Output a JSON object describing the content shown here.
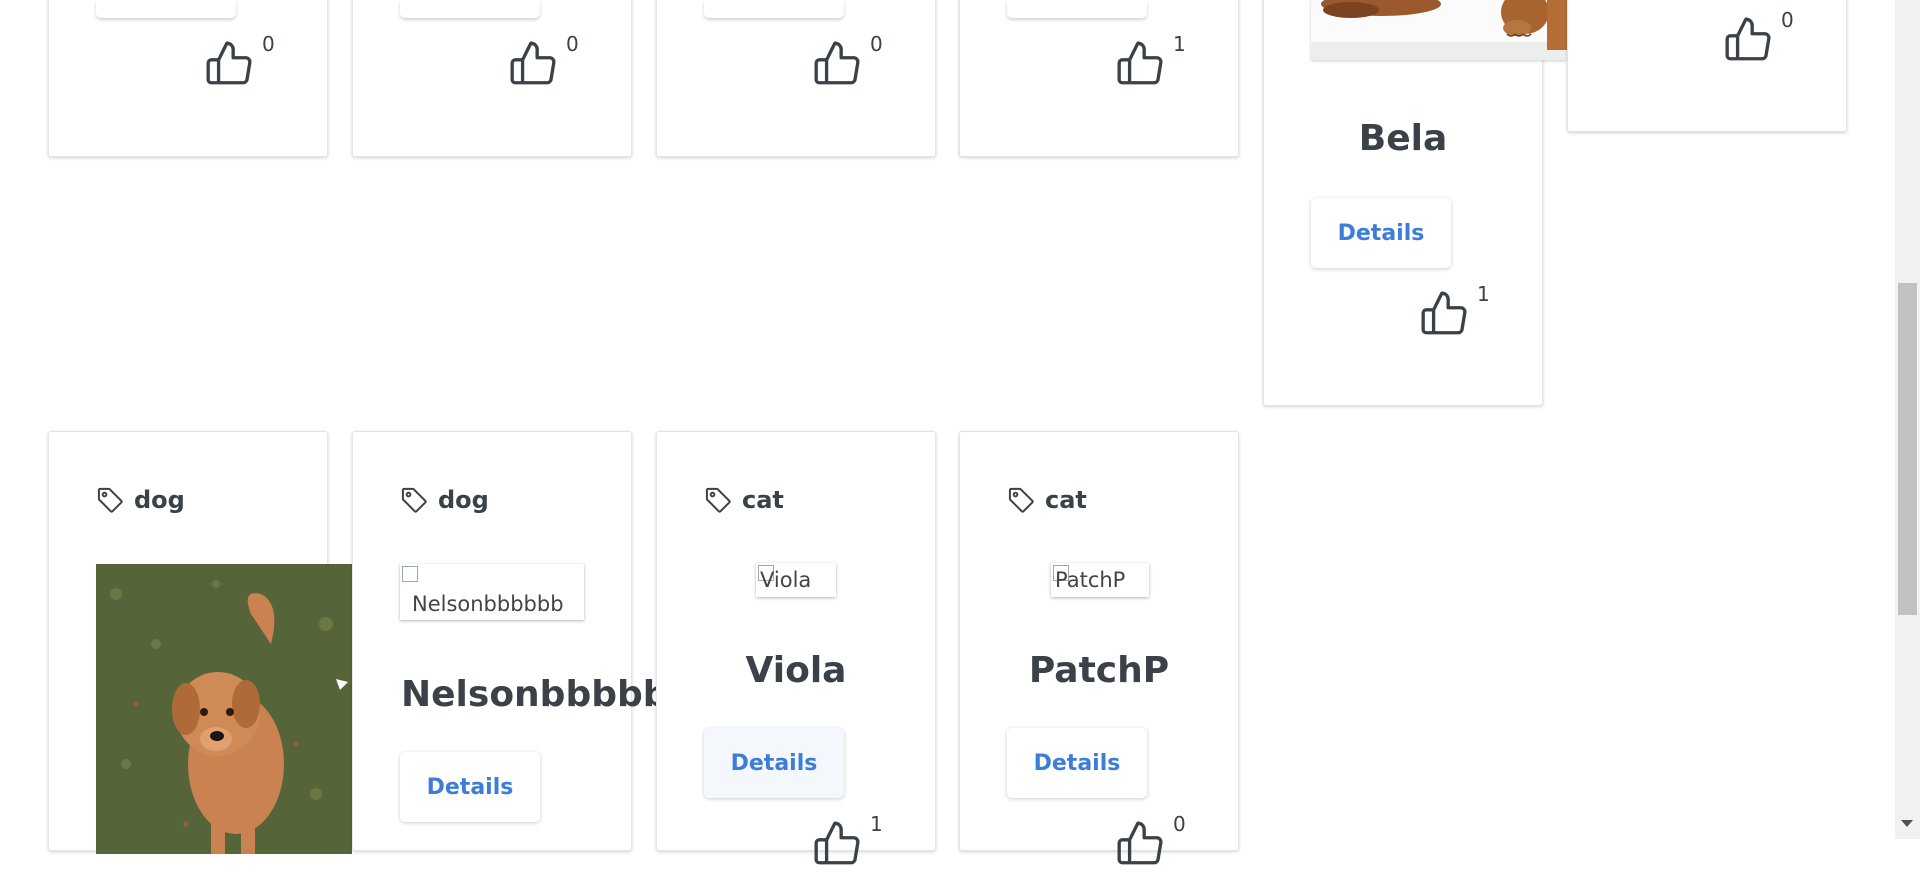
{
  "colors": {
    "accent": "#3b7dd8",
    "text": "#3b4148",
    "card_border": "#e2e4e7"
  },
  "top_row": {
    "likes": [
      "0",
      "0",
      "0",
      "1"
    ],
    "last_card_likes": "0"
  },
  "bela": {
    "name": "Bela",
    "details_label": "Details",
    "likes": "1"
  },
  "bottom_row": [
    {
      "tag_icon": "tag-icon",
      "tag": "dog",
      "image_alt": "",
      "name": "",
      "details_label": "",
      "likes": ""
    },
    {
      "tag_icon": "tag-icon",
      "tag": "dog",
      "image_alt": "Nelsonbbbbbb",
      "name": "Nelsonbbbbbb",
      "details_label": "Details"
    },
    {
      "tag_icon": "tag-icon",
      "tag": "cat",
      "image_alt": "Viola",
      "name": "Viola",
      "details_label": "Details",
      "likes": "1"
    },
    {
      "tag_icon": "tag-icon",
      "tag": "cat",
      "image_alt": "PatchP",
      "name": "PatchP",
      "details_label": "Details",
      "likes": "0"
    }
  ]
}
